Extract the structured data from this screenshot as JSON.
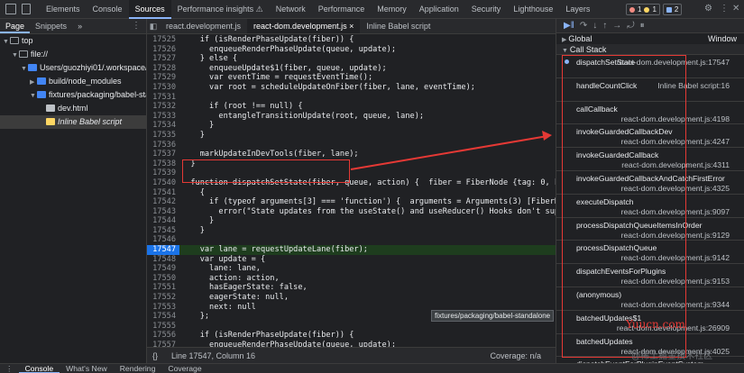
{
  "toolbar": {
    "tabs": [
      "Elements",
      "Console",
      "Sources",
      "Performance insights ⚠",
      "Network",
      "Performance",
      "Memory",
      "Application",
      "Security",
      "Lighthouse",
      "Layers"
    ],
    "errors": "1",
    "warnings": "1",
    "issues": "2"
  },
  "navigator": {
    "tabs": [
      "Page",
      "Snippets"
    ],
    "more": "»",
    "tree": [
      {
        "label": "top",
        "indent": 0,
        "arrow": "▼",
        "icon": "frame-icon"
      },
      {
        "label": "file://",
        "indent": 1,
        "arrow": "▼",
        "icon": "cloud-icon"
      },
      {
        "label": "Users/guozhiyi01/.workspace/p",
        "indent": 2,
        "arrow": "▼",
        "icon": "folder-icon"
      },
      {
        "label": "build/node_modules",
        "indent": 3,
        "arrow": "▶",
        "icon": "folder-icon"
      },
      {
        "label": "fixtures/packaging/babel-star",
        "indent": 3,
        "arrow": "▼",
        "icon": "folder-icon"
      },
      {
        "label": "dev.html",
        "indent": 4,
        "arrow": "",
        "icon": "file-icon"
      },
      {
        "label": "Inline Babel script",
        "indent": 4,
        "arrow": "",
        "icon": "script-icon",
        "selected": true
      }
    ]
  },
  "editor": {
    "file_tabs": [
      "react.development.js",
      "react-dom.development.js",
      "Inline Babel script"
    ],
    "active_tab": 1,
    "lines": [
      {
        "n": "17525",
        "t": "    if (isRenderPhaseUpdate(fiber)) {"
      },
      {
        "n": "17526",
        "t": "      enqueueRenderPhaseUpdate(queue, update);"
      },
      {
        "n": "17527",
        "t": "    } else {"
      },
      {
        "n": "17528",
        "t": "      enqueueUpdate$1(fiber, queue, update);"
      },
      {
        "n": "17529",
        "t": "      var eventTime = requestEventTime();"
      },
      {
        "n": "17530",
        "t": "      var root = scheduleUpdateOnFiber(fiber, lane, eventTime);"
      },
      {
        "n": "17531",
        "t": ""
      },
      {
        "n": "17532",
        "t": "      if (root !== null) {"
      },
      {
        "n": "17533",
        "t": "        entangleTransitionUpdate(root, queue, lane);"
      },
      {
        "n": "17534",
        "t": "      }"
      },
      {
        "n": "17535",
        "t": "    }"
      },
      {
        "n": "17536",
        "t": ""
      },
      {
        "n": "17537",
        "t": "    markUpdateInDevTools(fiber, lane);"
      },
      {
        "n": "17538",
        "t": "  }"
      },
      {
        "n": "17539",
        "t": ""
      },
      {
        "n": "17540",
        "t": "  function dispatchSetState(fiber, queue, action) {  fiber = FiberNode {tag: 0, ke"
      },
      {
        "n": "17541",
        "t": "    {"
      },
      {
        "n": "17542",
        "t": "      if (typeof arguments[3] === 'function') {  arguments = Arguments(3) [FiberNo"
      },
      {
        "n": "17543",
        "t": "        error(\"State updates from the useState() and useReducer() Hooks don't supp"
      },
      {
        "n": "17544",
        "t": "      }"
      },
      {
        "n": "17545",
        "t": "    }"
      },
      {
        "n": "17546",
        "t": ""
      },
      {
        "n": "17547",
        "t": "    var lane = requestUpdateLane(fiber);",
        "hl": true
      },
      {
        "n": "17548",
        "t": "    var update = {"
      },
      {
        "n": "17549",
        "t": "      lane: lane,"
      },
      {
        "n": "17550",
        "t": "      action: action,"
      },
      {
        "n": "17551",
        "t": "      hasEagerState: false,"
      },
      {
        "n": "17552",
        "t": "      eagerState: null,"
      },
      {
        "n": "17553",
        "t": "      next: null"
      },
      {
        "n": "17554",
        "t": "    };"
      },
      {
        "n": "17555",
        "t": ""
      },
      {
        "n": "17556",
        "t": "    if (isRenderPhaseUpdate(fiber)) {"
      },
      {
        "n": "17557",
        "t": "      enqueueRenderPhaseUpdate(queue, update);"
      },
      {
        "n": "17558",
        "t": "    } else {"
      },
      {
        "n": "17559",
        "t": "      enqueueUpdate$1(fiber, queue, update);"
      }
    ],
    "tooltip": "fixtures/packaging/babel-standalone",
    "status": {
      "brace": "{}",
      "position": "Line 17547, Column 16",
      "coverage": "Coverage: n/a"
    }
  },
  "debugger": {
    "scope_global": "Global",
    "scope_window": "Window",
    "call_stack_label": "Call Stack",
    "frames": [
      {
        "fn": "dispatchSetState",
        "loc": "react-dom.development.js:17547",
        "current": true,
        "one_line": true
      },
      {
        "fn": "handleCountClick",
        "loc": "Inline Babel script:16",
        "one_line": true
      },
      {
        "fn": "callCallback",
        "loc": "react-dom.development.js:4198"
      },
      {
        "fn": "invokeGuardedCallbackDev",
        "loc": "react-dom.development.js:4247"
      },
      {
        "fn": "invokeGuardedCallback",
        "loc": "react-dom.development.js:4311"
      },
      {
        "fn": "invokeGuardedCallbackAndCatchFirstError",
        "loc": "react-dom.development.js:4325"
      },
      {
        "fn": "executeDispatch",
        "loc": "react-dom.development.js:9097"
      },
      {
        "fn": "processDispatchQueueItemsInOrder",
        "loc": "react-dom.development.js:9129"
      },
      {
        "fn": "processDispatchQueue",
        "loc": "react-dom.development.js:9142"
      },
      {
        "fn": "dispatchEventsForPlugins",
        "loc": "react-dom.development.js:9153"
      },
      {
        "fn": "(anonymous)",
        "loc": "react-dom.development.js:9344"
      },
      {
        "fn": "batchedUpdates$1",
        "loc": "react-dom.development.js:26909"
      },
      {
        "fn": "batchedUpdates",
        "loc": "react-dom.development.js:4025"
      },
      {
        "fn": "dispatchEventForPluginEventSystem",
        "loc": ""
      }
    ]
  },
  "drawer": {
    "tabs": [
      "Console",
      "What's New",
      "Rendering",
      "Coverage"
    ]
  },
  "watermark": {
    "site": "Yuucn.com",
    "text": "@稀土掘金技术社区"
  },
  "colors": {
    "accent": "#8ab4f8",
    "annotation": "#e53935",
    "highlight_line": "#1e3d1e"
  }
}
